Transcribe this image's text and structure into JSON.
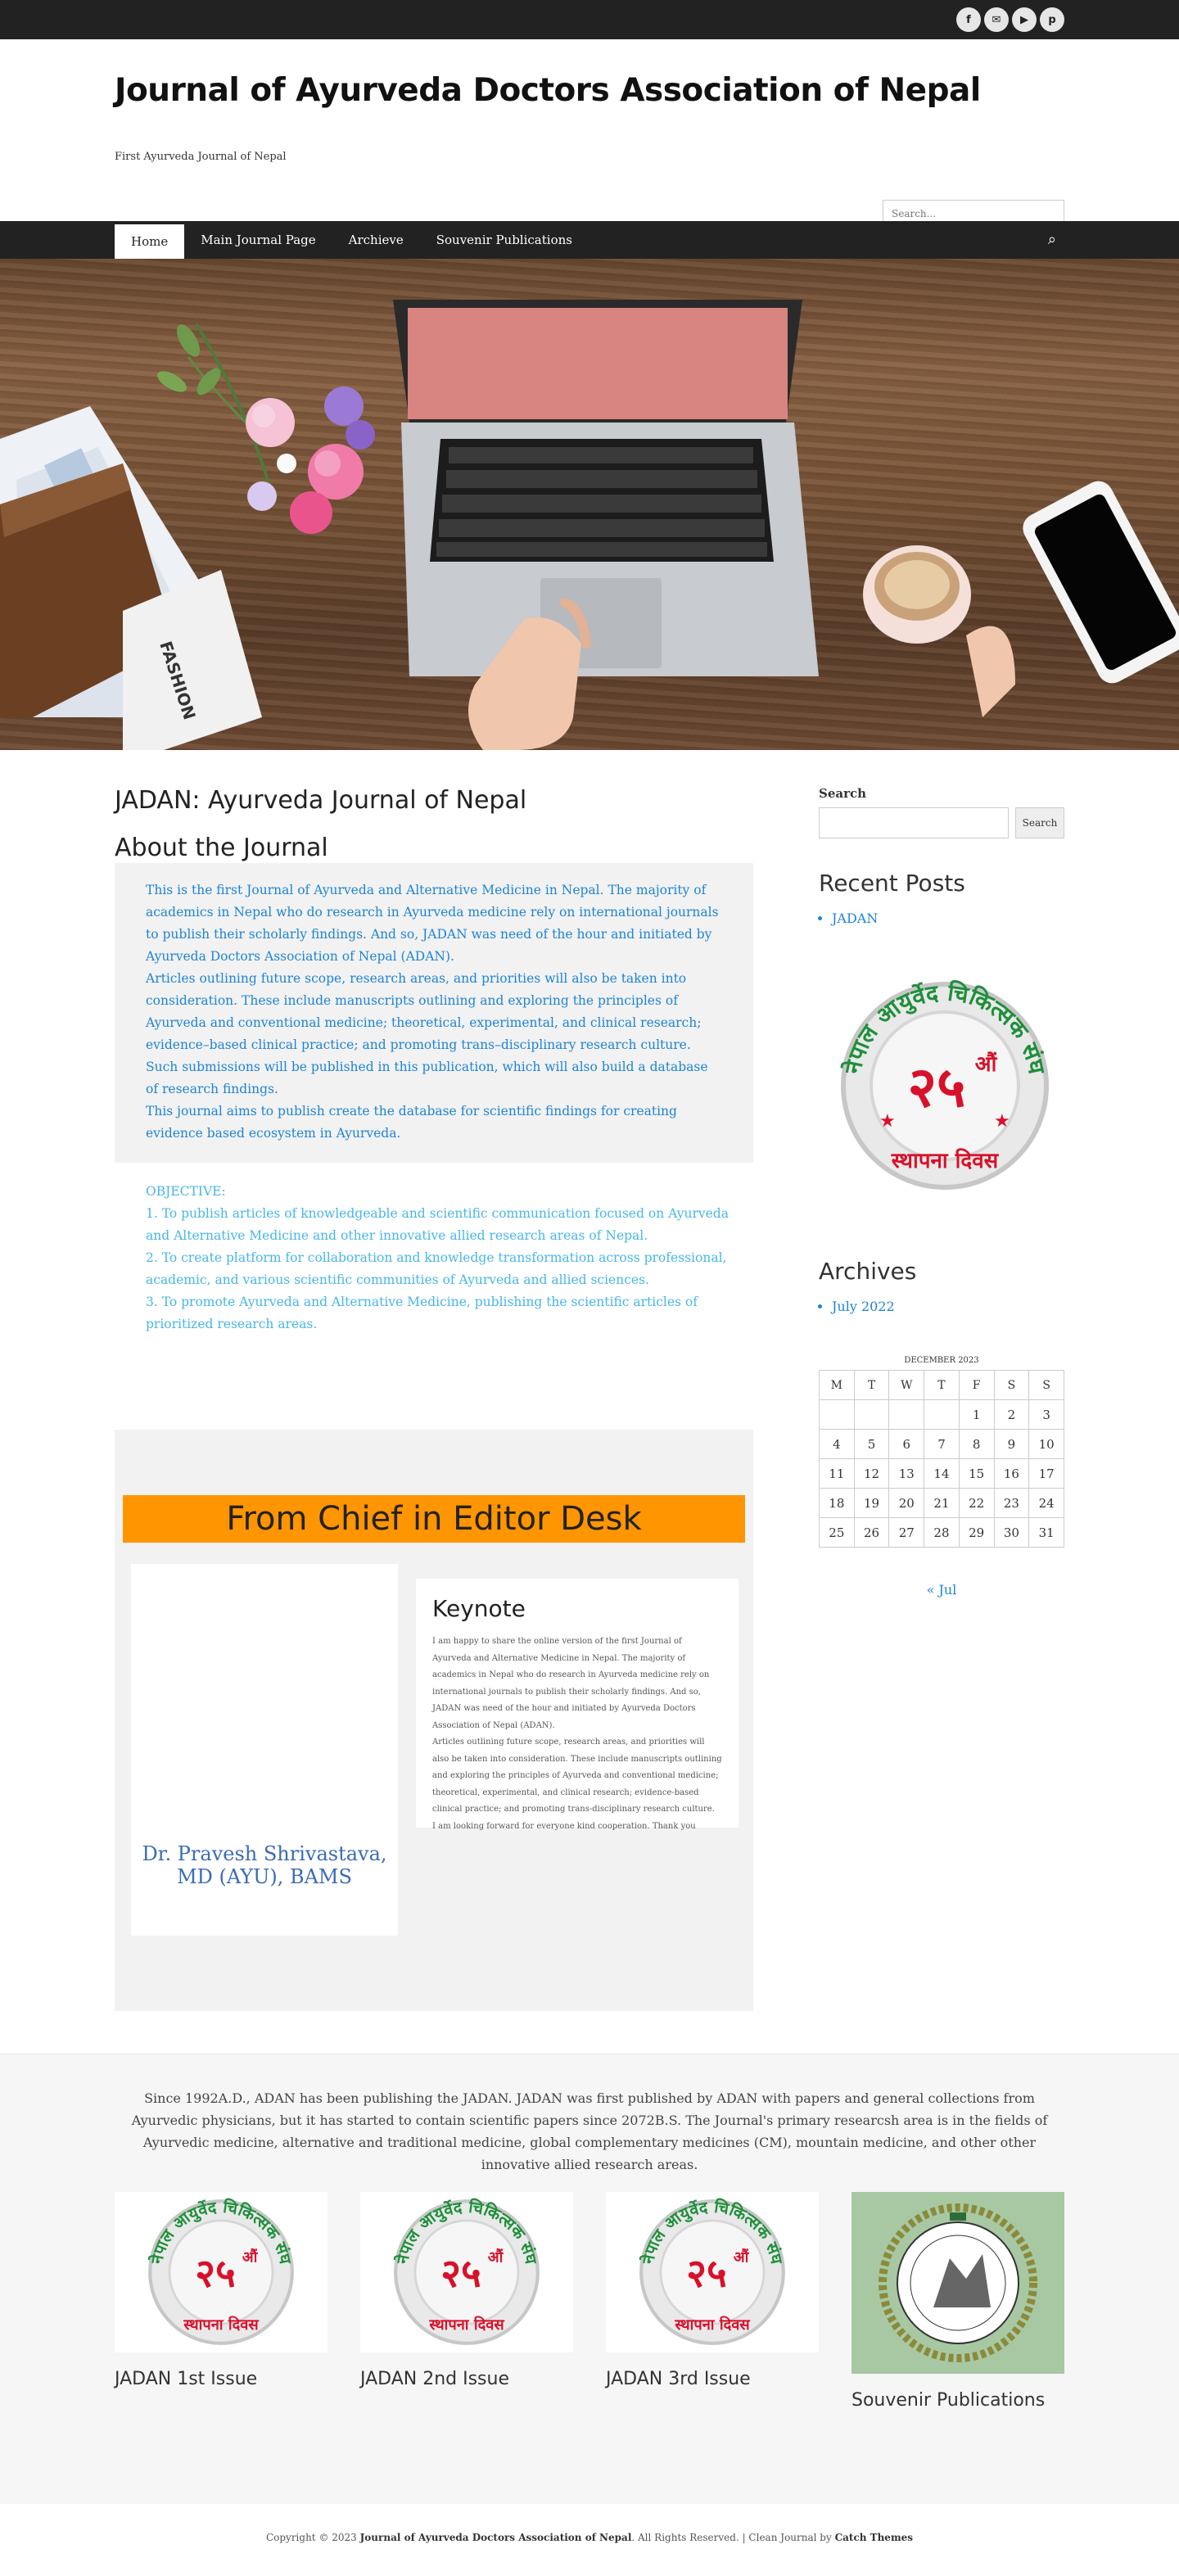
{
  "topbar": {
    "social": [
      {
        "icon": "facebook-icon",
        "glyph": "f"
      },
      {
        "icon": "email-icon",
        "glyph": "✉"
      },
      {
        "icon": "youtube-icon",
        "glyph": "▶"
      },
      {
        "icon": "pinterest-icon",
        "glyph": "p"
      }
    ]
  },
  "header": {
    "title": "Journal of Ayurveda Doctors Association of Nepal",
    "tagline": "First Ayurveda Journal of Nepal",
    "search_placeholder": "Search..."
  },
  "nav": {
    "items": [
      "Home",
      "Main Journal Page",
      "Archieve",
      "Souvenir Publications"
    ],
    "active": "Home"
  },
  "main": {
    "page_title": "JADAN: Ayurveda Journal of Nepal",
    "about_title": "About the Journal",
    "about_paragraphs": [
      "This is the first Journal of Ayurveda and Alternative Medicine in Nepal. The majority of academics in Nepal who do research in Ayurveda medicine rely on international journals to publish their scholarly findings. And so, JADAN was need of the hour and initiated by Ayurveda Doctors Association of Nepal (ADAN).",
      "Articles outlining future scope, research areas, and priorities will also be taken into consideration. These include manuscripts outlining and exploring the principles of Ayurveda and conventional medicine; theoretical, experimental, and clinical research; evidence–based clinical practice; and promoting trans–disciplinary research culture. Such submissions will be published in this publication, which will also build a database of research findings.",
      "This journal aims to publish create the database for scientific findings for creating evidence based ecosystem in Ayurveda."
    ],
    "objective_heading": "OBJECTIVE:",
    "objectives": [
      "1. To publish articles of knowledgeable and scientific communication focused on Ayurveda and Alternative Medicine and other innovative allied research areas of Nepal.",
      "2. To create platform for collaboration and knowledge transformation across professional, academic, and various scientific communities of Ayurveda and allied sciences.",
      "3. To promote Ayurveda and Alternative Medicine, publishing the scientific articles of prioritized research areas."
    ],
    "editor_banner": "From Chief in Editor Desk",
    "editor_name": "Dr. Pravesh Shrivastava, MD (AYU), BAMS",
    "keynote_title": "Keynote",
    "keynote_paragraphs": [
      "I am happy to share the online version of  the first Journal of Ayurveda and Alternative Medicine in Nepal. The majority of academics in Nepal who do research in Ayurveda medicine rely on international journals to publish their scholarly findings. And so, JADAN was need of the hour and initiated by Ayurveda Doctors Association of Nepal (ADAN).",
      "Articles outlining future scope, research areas, and priorities will also be taken into consideration. These include manuscripts outlining and exploring the principles of Ayurveda and conventional medicine; theoretical, experimental, and clinical research; evidence-based clinical practice; and promoting trans-disciplinary research culture.",
      "I am looking forward for everyone kind cooperation. Thank you"
    ]
  },
  "sidebar": {
    "search_label": "Search",
    "search_button": "Search",
    "recent_posts_title": "Recent Posts",
    "recent_posts": [
      "JADAN"
    ],
    "archives_title": "Archives",
    "archives": [
      "July 2022"
    ],
    "calendar": {
      "caption": "DECEMBER 2023",
      "weekdays": [
        "M",
        "T",
        "W",
        "T",
        "F",
        "S",
        "S"
      ],
      "weeks": [
        [
          "",
          "",
          "",
          "",
          "1",
          "2",
          "3"
        ],
        [
          "4",
          "5",
          "6",
          "7",
          "8",
          "9",
          "10"
        ],
        [
          "11",
          "12",
          "13",
          "14",
          "15",
          "16",
          "17"
        ],
        [
          "18",
          "19",
          "20",
          "21",
          "22",
          "23",
          "24"
        ],
        [
          "25",
          "26",
          "27",
          "28",
          "29",
          "30",
          "31"
        ]
      ],
      "prev_link": "« Jul"
    },
    "logo_text": {
      "arc": "नेपाल आयुर्वेद चिकित्सक संघ",
      "number": "२५",
      "suffix": "औं",
      "bottom": "स्थापना दिवस"
    }
  },
  "footer_widgets": {
    "about": "Since 1992A.D., ADAN has been publishing the JADAN. JADAN was first published by ADAN with papers and general collections from Ayurvedic physicians, but it has started to contain scientific papers since 2072B.S. The Journal's primary researcsh area is in the fields of Ayurvedic medicine, alternative and traditional medicine, global complementary medicines (CM), mountain medicine, and other other innovative allied research areas.",
    "issues": [
      "JADAN 1st Issue",
      "JADAN 2nd Issue",
      "JADAN 3rd Issue",
      "Souvenir Publications"
    ]
  },
  "footer": {
    "prefix": "Copyright © 2023 ",
    "site": "Journal of Ayurveda Doctors Association of Nepal",
    "middle": ". All Rights Reserved.  |  Clean Journal by ",
    "theme_author": "Catch Themes"
  },
  "colors": {
    "link": "#1e84d4",
    "objective": "#48b6e8",
    "banner": "#ff9500",
    "logo_red": "#d8102a",
    "logo_green": "#1e8f3a",
    "dark_bar": "#222222"
  }
}
